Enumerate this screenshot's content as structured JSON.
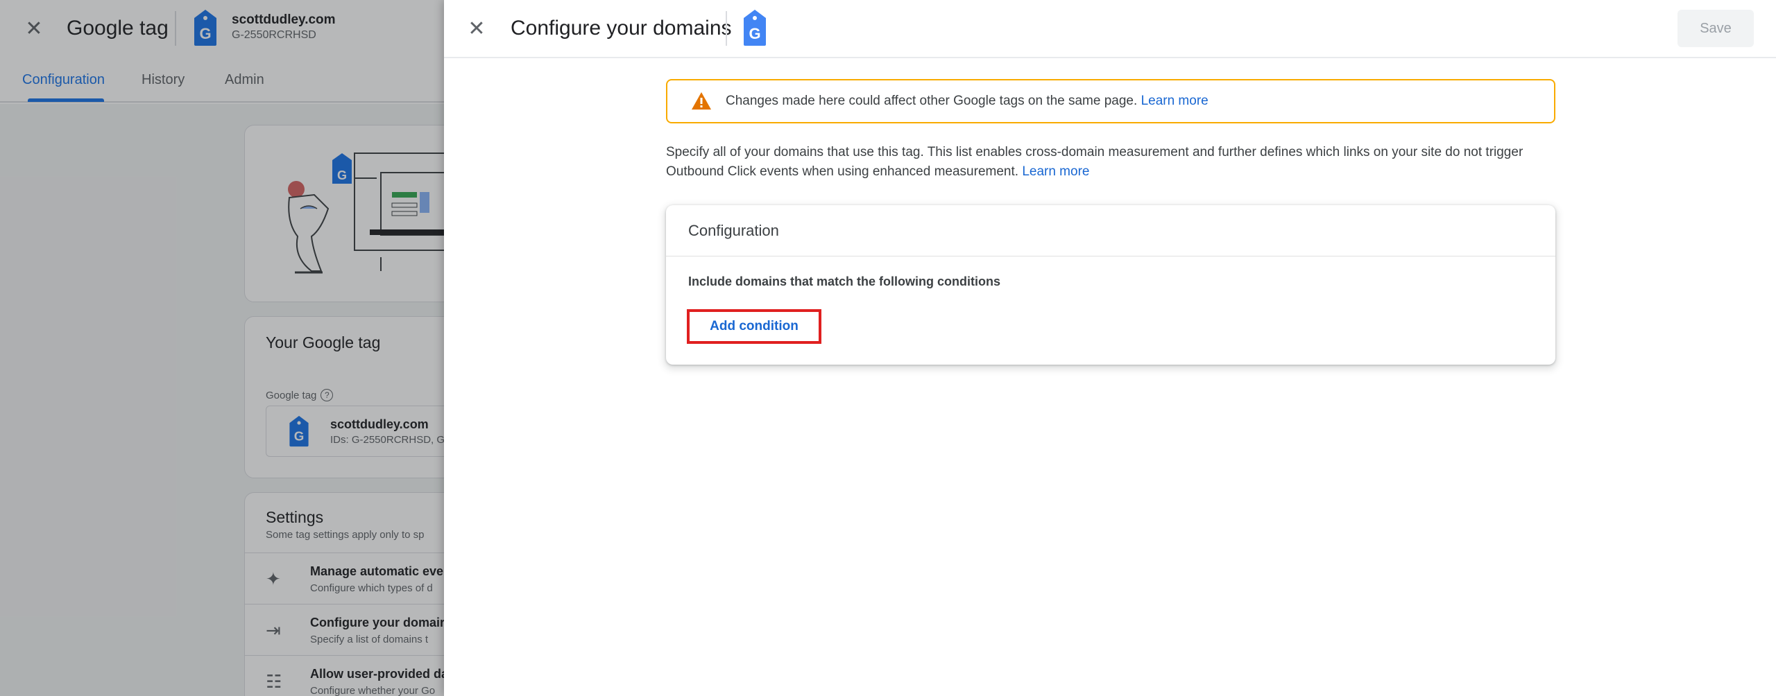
{
  "background": {
    "title": "Google tag",
    "account": {
      "domain": "scottdudley.com",
      "id": "G-2550RCRHSD"
    },
    "tabs": [
      "Configuration",
      "History",
      "Admin"
    ],
    "your_tag_card": {
      "heading": "Your Google tag",
      "label": "Google tag",
      "name": "scottdudley.com",
      "ids": "IDs: G-2550RCRHSD, G"
    },
    "settings_card": {
      "heading": "Settings",
      "subtitle": "Some tag settings apply only to sp",
      "rows": [
        {
          "title": "Manage automatic eve",
          "sub": "Configure which types of d",
          "icon": "sparkle-icon"
        },
        {
          "title": "Configure your domair",
          "sub": "Specify a list of domains t",
          "icon": "merge-arrows-icon"
        },
        {
          "title": "Allow user-provided da",
          "sub": "Configure whether your Go",
          "icon": "user-data-icon"
        }
      ]
    }
  },
  "panel": {
    "title": "Configure your domains",
    "save_label": "Save",
    "warning": {
      "text": "Changes made here could affect other Google tags on the same page.",
      "link": "Learn more"
    },
    "description": {
      "text": "Specify all of your domains that use this tag. This list enables cross-domain measurement and further defines which links on your site do not trigger Outbound Click events when using enhanced measurement.",
      "link": "Learn more"
    },
    "config_card": {
      "title": "Configuration",
      "condition_label": "Include domains that match the following conditions",
      "add_condition_label": "Add condition"
    }
  },
  "colors": {
    "accent": "#1a73e8",
    "link": "#1967d2",
    "warning": "#f9ab00",
    "highlight": "#e02020"
  }
}
